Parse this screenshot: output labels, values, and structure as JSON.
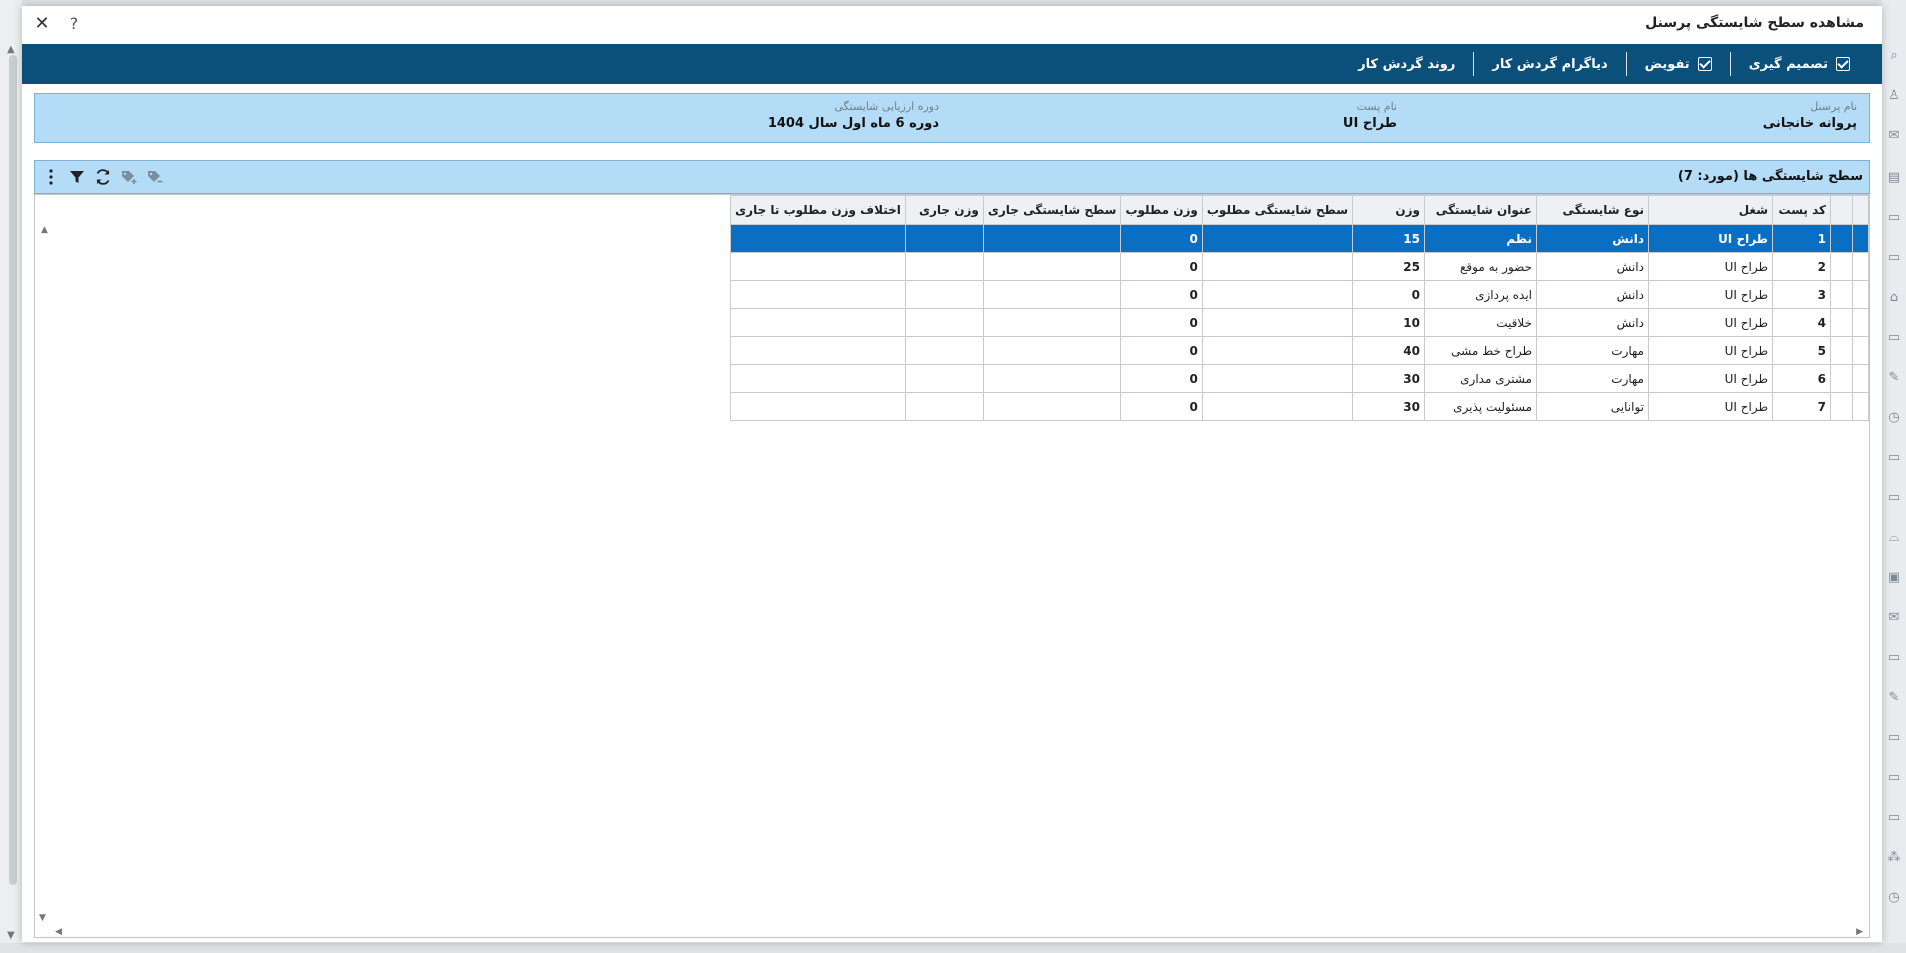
{
  "window": {
    "title": "مشاهده سطح شایستگی پرسنل",
    "close_glyph": "✕",
    "help_glyph": "?"
  },
  "toolbar": {
    "items": [
      {
        "label": "تصمیم گیری",
        "icon": "checkbox-icon"
      },
      {
        "label": "تفویض",
        "icon": "checkbox-icon"
      },
      {
        "label": "دیاگرام گردش کار"
      },
      {
        "label": "روند گردش کار"
      }
    ]
  },
  "info": {
    "personnel_label": "نام پرسنل",
    "personnel_value": "پروانه خانجانی",
    "post_label": "نام پست",
    "post_value": "طراح UI",
    "period_label": "دوره ارزیابی شایستگی",
    "period_value": "دوره 6 ماه اول سال 1404"
  },
  "grid": {
    "title": "سطح شایستگی ها (مورد: 7)",
    "tools": [
      "more-vertical-icon",
      "filter-icon",
      "refresh-icon",
      "add-tag-icon",
      "remove-tag-icon"
    ],
    "columns": [
      "",
      "",
      "کد پست",
      "شغل",
      "نوع شایستگی",
      "عنوان شایستگی",
      "وزن",
      "سطح شایستگی مطلوب",
      "وزن مطلوب",
      "سطح شایستگی جاری",
      "وزن جاری",
      "اختلاف وزن مطلوب تا جاری"
    ],
    "rows": [
      {
        "code": "1",
        "job": "طراح UI",
        "type": "دانش",
        "title": "نظم",
        "weight": "15",
        "req_level": "",
        "req_weight": "0",
        "cur_level": "",
        "cur_weight": "",
        "diff": "",
        "selected": true
      },
      {
        "code": "2",
        "job": "طراح UI",
        "type": "دانش",
        "title": "حضور به موقع",
        "weight": "25",
        "req_level": "",
        "req_weight": "0",
        "cur_level": "",
        "cur_weight": "",
        "diff": ""
      },
      {
        "code": "3",
        "job": "طراح UI",
        "type": "دانش",
        "title": "ایده پردازی",
        "weight": "0",
        "req_level": "",
        "req_weight": "0",
        "cur_level": "",
        "cur_weight": "",
        "diff": ""
      },
      {
        "code": "4",
        "job": "طراح UI",
        "type": "دانش",
        "title": "خلاقیت",
        "weight": "10",
        "req_level": "",
        "req_weight": "0",
        "cur_level": "",
        "cur_weight": "",
        "diff": ""
      },
      {
        "code": "5",
        "job": "طراح UI",
        "type": "مهارت",
        "title": "طراح خط مشی",
        "weight": "40",
        "req_level": "",
        "req_weight": "0",
        "cur_level": "",
        "cur_weight": "",
        "diff": ""
      },
      {
        "code": "6",
        "job": "طراح UI",
        "type": "مهارت",
        "title": "مشتری مداری",
        "weight": "30",
        "req_level": "",
        "req_weight": "0",
        "cur_level": "",
        "cur_weight": "",
        "diff": ""
      },
      {
        "code": "7",
        "job": "طراح UI",
        "type": "توانایی",
        "title": "مسئولیت پذیری",
        "weight": "30",
        "req_level": "",
        "req_weight": "0",
        "cur_level": "",
        "cur_weight": "",
        "diff": ""
      }
    ]
  },
  "colors": {
    "toolbar_bg": "#0b4f7b",
    "info_bg": "#b5dcf7",
    "selected_row": "#0a6fc2"
  }
}
